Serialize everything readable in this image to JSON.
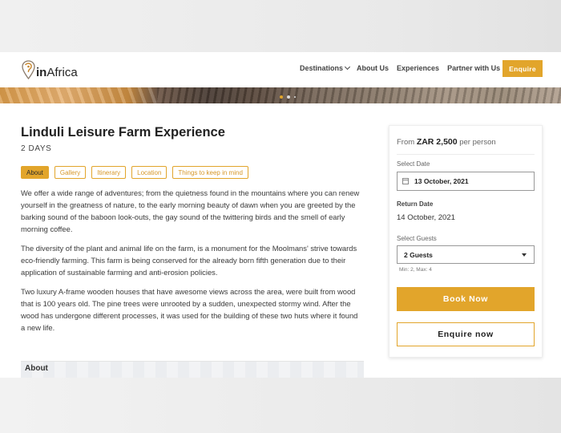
{
  "header": {
    "logo_text_bold": "in",
    "logo_text_rest": "Africa",
    "nav": [
      {
        "label": "Destinations",
        "has_dropdown": true
      },
      {
        "label": "About Us",
        "has_dropdown": false
      },
      {
        "label": "Experiences",
        "has_dropdown": false
      },
      {
        "label": "Partner with Us",
        "has_dropdown": false
      }
    ],
    "enquire_label": "Enquire"
  },
  "colors": {
    "accent": "#e2a52b"
  },
  "hero": {
    "slides": 3,
    "active_slide": 1
  },
  "main": {
    "title": "Linduli Leisure Farm Experience",
    "duration": "2 DAYS",
    "tabs": [
      {
        "label": "About",
        "active": true
      },
      {
        "label": "Gallery",
        "active": false
      },
      {
        "label": "Itinerary",
        "active": false
      },
      {
        "label": "Location",
        "active": false
      },
      {
        "label": "Things to keep in mind",
        "active": false
      }
    ],
    "paragraphs": [
      "We offer a wide range of adventures;  from the quietness found in the mountains where you can renew yourself in the greatness of nature, to the early morning beauty of dawn when you are greeted by the barking sound of the baboon look-outs, the gay sound of the twittering birds and the smell of early morning coffee.",
      "The diversity of the plant and animal life on the farm, is a monument for the Moolmans' strive towards eco-friendly farming. This farm is being conserved for the already born fifth generation due to their application of sustainable farming and anti-erosion policies.",
      "Two luxury A-frame wooden houses that have awesome views across the area, were built from wood that is 100 years old. The pine trees were unrooted by a sudden, unexpected stormy wind. After the wood has undergone different processes, it was used for the building of these two huts where it found a new life."
    ],
    "section_heading": "About"
  },
  "booking": {
    "price_prefix": "From",
    "price_value": "ZAR 2,500",
    "price_suffix": "per person",
    "select_date_label": "Select Date",
    "select_date_value": "13 October, 2021",
    "return_date_label": "Return Date",
    "return_date_value": "14 October, 2021",
    "select_guests_label": "Select Guests",
    "guests_value": "2 Guests",
    "guests_limits": "Min: 2, Max: 4",
    "book_label": "Book Now",
    "enquire_now_label": "Enquire now"
  }
}
